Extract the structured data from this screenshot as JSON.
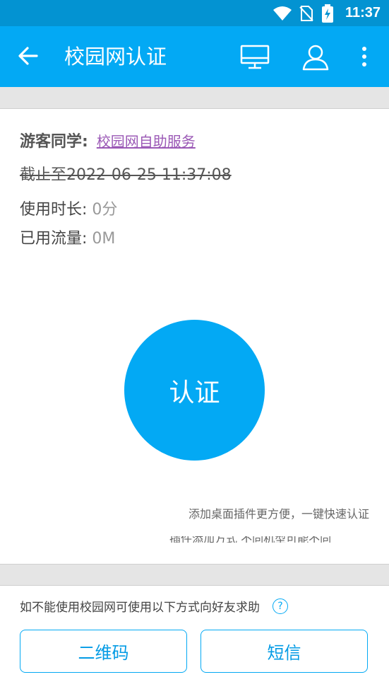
{
  "status_bar": {
    "time": "11:37"
  },
  "app_bar": {
    "title": "校园网认证",
    "back_icon": "arrow-back-icon",
    "actions": [
      "monitor-icon",
      "person-icon",
      "more-vert-icon"
    ]
  },
  "info": {
    "guest_label": "游客同学:",
    "self_service_link": "校园网自助服务",
    "deadline": "截止至2022-06-25 11:37:08",
    "usage_time_label": "使用时长:",
    "usage_time_value": "0分",
    "traffic_label": "已用流量:",
    "traffic_value": "0M"
  },
  "auth_button": {
    "label": "认证"
  },
  "tips": {
    "widget_tip": "添加桌面插件更方便，一键快速认证",
    "widget_tip2": "插件添加方式 不同机型可能不同"
  },
  "help": {
    "text": "如不能使用校园网可使用以下方式向好友求助",
    "icon": "help-circle-icon",
    "help_glyph": "?",
    "qr_button": "二维码",
    "sms_button": "短信"
  },
  "colors": {
    "primary": "#03a9f4",
    "status_bar": "#0393d2",
    "link": "#9b59b6"
  }
}
